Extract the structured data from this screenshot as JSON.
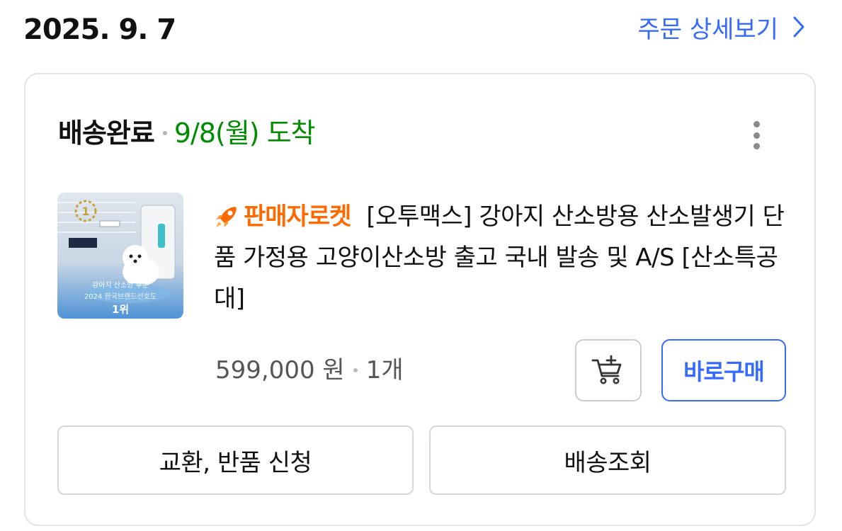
{
  "order": {
    "date": "2025. 9. 7",
    "detail_link_label": "주문 상세보기"
  },
  "shipment": {
    "status": "배송완료",
    "arrival": "9/8(월) 도착"
  },
  "product": {
    "badge_label": "판매자로켓",
    "title": "[오투맥스] 강아지 산소방용 산소발생기 단품 가정용 고양이산소방 출고 국내 발송 및 A/S [산소특공대]",
    "price": "599,000 원",
    "quantity": "1개",
    "thumbnail": {
      "caption_line1": "강아지 산소방 부문",
      "caption_line2": "2024 한국브랜드선호도",
      "rank": "1위",
      "award_digit": "1"
    }
  },
  "actions": {
    "buy_now_label": "바로구매",
    "exchange_return_label": "교환, 반품 신청",
    "tracking_label": "배송조회"
  },
  "icons": {
    "detail_chevron": "chevron-right-icon",
    "more": "more-vertical-icon",
    "cart_add": "cart-plus-icon",
    "rocket": "rocket-icon"
  },
  "colors": {
    "accent_blue": "#346aff",
    "arrival_green": "#008c00",
    "rocket_orange": "#ff6a00"
  }
}
